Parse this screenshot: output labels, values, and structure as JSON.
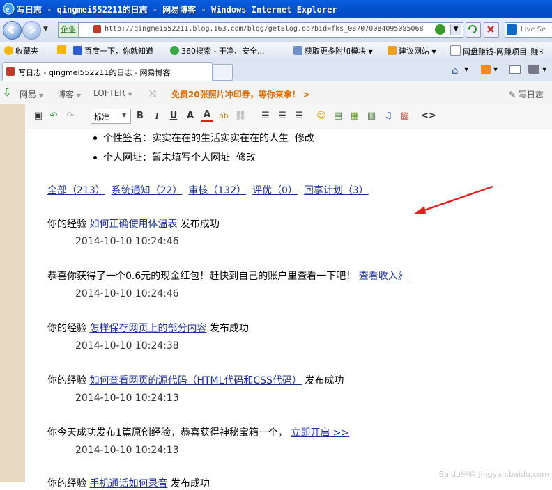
{
  "window": {
    "title": "写日志 - qingmei552211的日志 - 网易博客 - Windows Internet Explorer"
  },
  "address": {
    "zone": "企业",
    "url": "http://qingmei552211.blog.163.com/blog/getBlog.do?bid=fks_087070084095085068",
    "search_placeholder": "Live Se"
  },
  "favorites": {
    "items": [
      {
        "label": "收藏夹"
      },
      {
        "label": "百度一下，你就知道"
      },
      {
        "label": "360搜索 - 干净、安全..."
      },
      {
        "label": "获取更多附加模块"
      },
      {
        "label": "建议网站"
      },
      {
        "label": "网盘赚钱-网赚项目_赚3"
      }
    ]
  },
  "tabs": [
    {
      "label": "写日志 - qingmei552211的日志 - 网易博客"
    }
  ],
  "netease": {
    "menu": [
      "网易",
      "博客",
      "LOFTER"
    ],
    "promo": "免费20张照片冲印券，等你来拿！",
    "write_label": "写日志"
  },
  "editor": {
    "format": "标准",
    "bold": "B",
    "italic": "I",
    "underline": "U",
    "strike": "A",
    "color": "A",
    "source": "<>"
  },
  "profile": {
    "lines": [
      "个性签名：实实在在的生活实实在在的人生",
      "个人网址：暂未填写个人网址"
    ],
    "edit_label": "修改"
  },
  "filters": [
    {
      "label": "全部（213）"
    },
    {
      "label": "系统通知（22）"
    },
    {
      "label": "审核（132）"
    },
    {
      "label": "评优（0）"
    },
    {
      "label": "回享计划（3）"
    }
  ],
  "notices": [
    {
      "prefix": "你的经验",
      "link": "如何正确使用体温表",
      "suffix": "发布成功",
      "time": "2014-10-10 10:24:46"
    },
    {
      "prefix": "恭喜你获得了一个0.6元的现金红包！赶快到自己的账户里查看一下吧！",
      "link": "查看收入》",
      "suffix": "",
      "time": "2014-10-10 10:24:46"
    },
    {
      "prefix": "你的经验",
      "link": "怎样保存网页上的部分内容",
      "suffix": "发布成功",
      "time": "2014-10-10 10:24:38"
    },
    {
      "prefix": "你的经验",
      "link": "如何查看网页的源代码（HTML代码和CSS代码）",
      "suffix": "发布成功",
      "time": "2014-10-10 10:24:13"
    },
    {
      "prefix": "你今天成功发布1篇原创经验，恭喜获得神秘宝箱一个，",
      "link": "立即开启 >>",
      "suffix": "",
      "time": "2014-10-10 10:24:13"
    },
    {
      "prefix": "你的经验",
      "link": "手机通话如何录音",
      "suffix": "发布成功",
      "time": ""
    }
  ],
  "watermark": "Baidu经验 jingyan.baidu.com",
  "colors": {
    "link": "#1d2f9a",
    "arrow": "#d9231f",
    "promo": "#e36b00"
  }
}
